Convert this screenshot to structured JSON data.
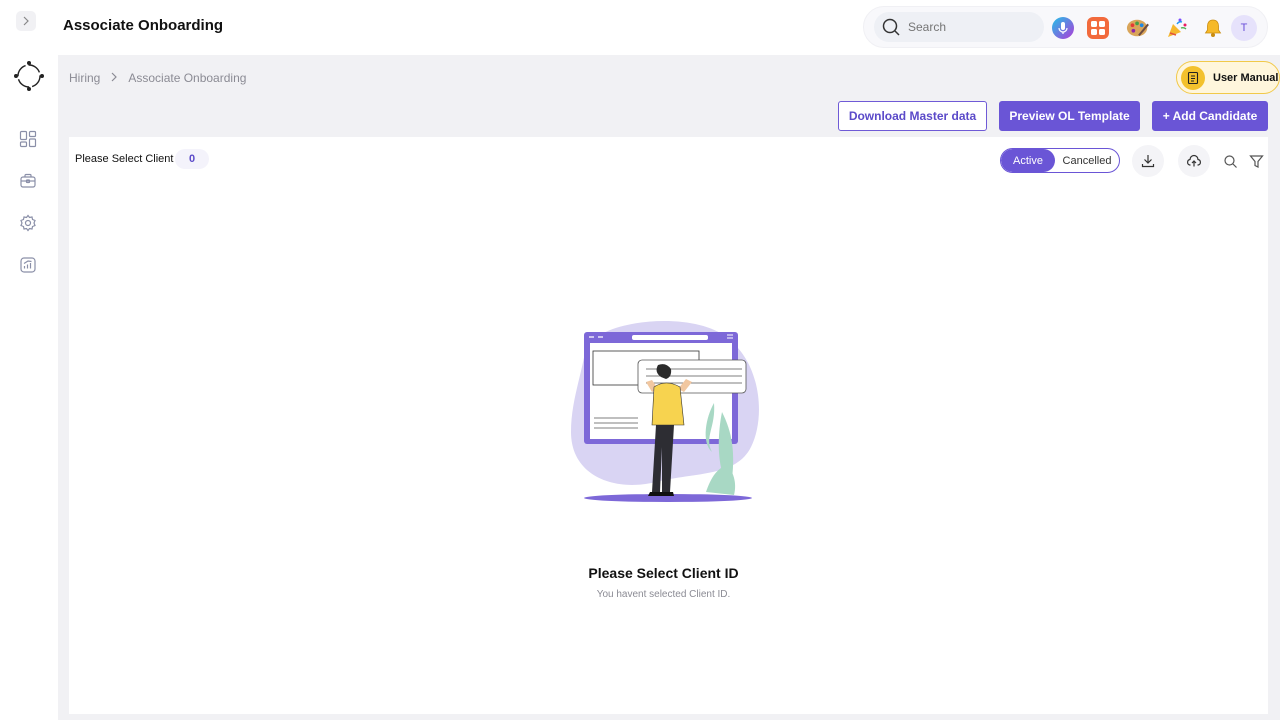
{
  "app": {
    "title": "Associate Onboarding"
  },
  "rail": {
    "expand_icon": "chevron-right-icon",
    "logo_icon": "orbit-logo-icon",
    "items": [
      {
        "icon": "dashboard-icon"
      },
      {
        "icon": "briefcase-icon"
      },
      {
        "icon": "settings-icon"
      },
      {
        "icon": "analytics-icon"
      }
    ]
  },
  "header": {
    "search_placeholder": "Search",
    "icons": [
      "microphone-icon",
      "apps-grid-icon",
      "palette-icon",
      "party-popper-icon",
      "bell-icon"
    ],
    "avatar_initial": "T"
  },
  "breadcrumb": {
    "items": [
      "Hiring",
      "Associate Onboarding"
    ]
  },
  "user_manual": {
    "label": "User Manual"
  },
  "toolbar": {
    "download_master": "Download Master data",
    "preview_ol": "Preview OL Template",
    "add_candidate": "+ Add Candidate"
  },
  "panel": {
    "client_label": "Please Select Client",
    "client_count": "0",
    "status_toggle": {
      "active": "Active",
      "cancelled": "Cancelled",
      "selected": "Active"
    },
    "actions": [
      "download-icon",
      "cloud-upload-icon",
      "search-icon",
      "filter-icon"
    ]
  },
  "empty_state": {
    "title": "Please Select Client ID",
    "subtitle": "You havent selected Client ID."
  },
  "colors": {
    "primary": "#6a55d6",
    "content_bg": "#f1f1f4",
    "manual_bg": "#fff6dc",
    "manual_border": "#f1c94a"
  }
}
